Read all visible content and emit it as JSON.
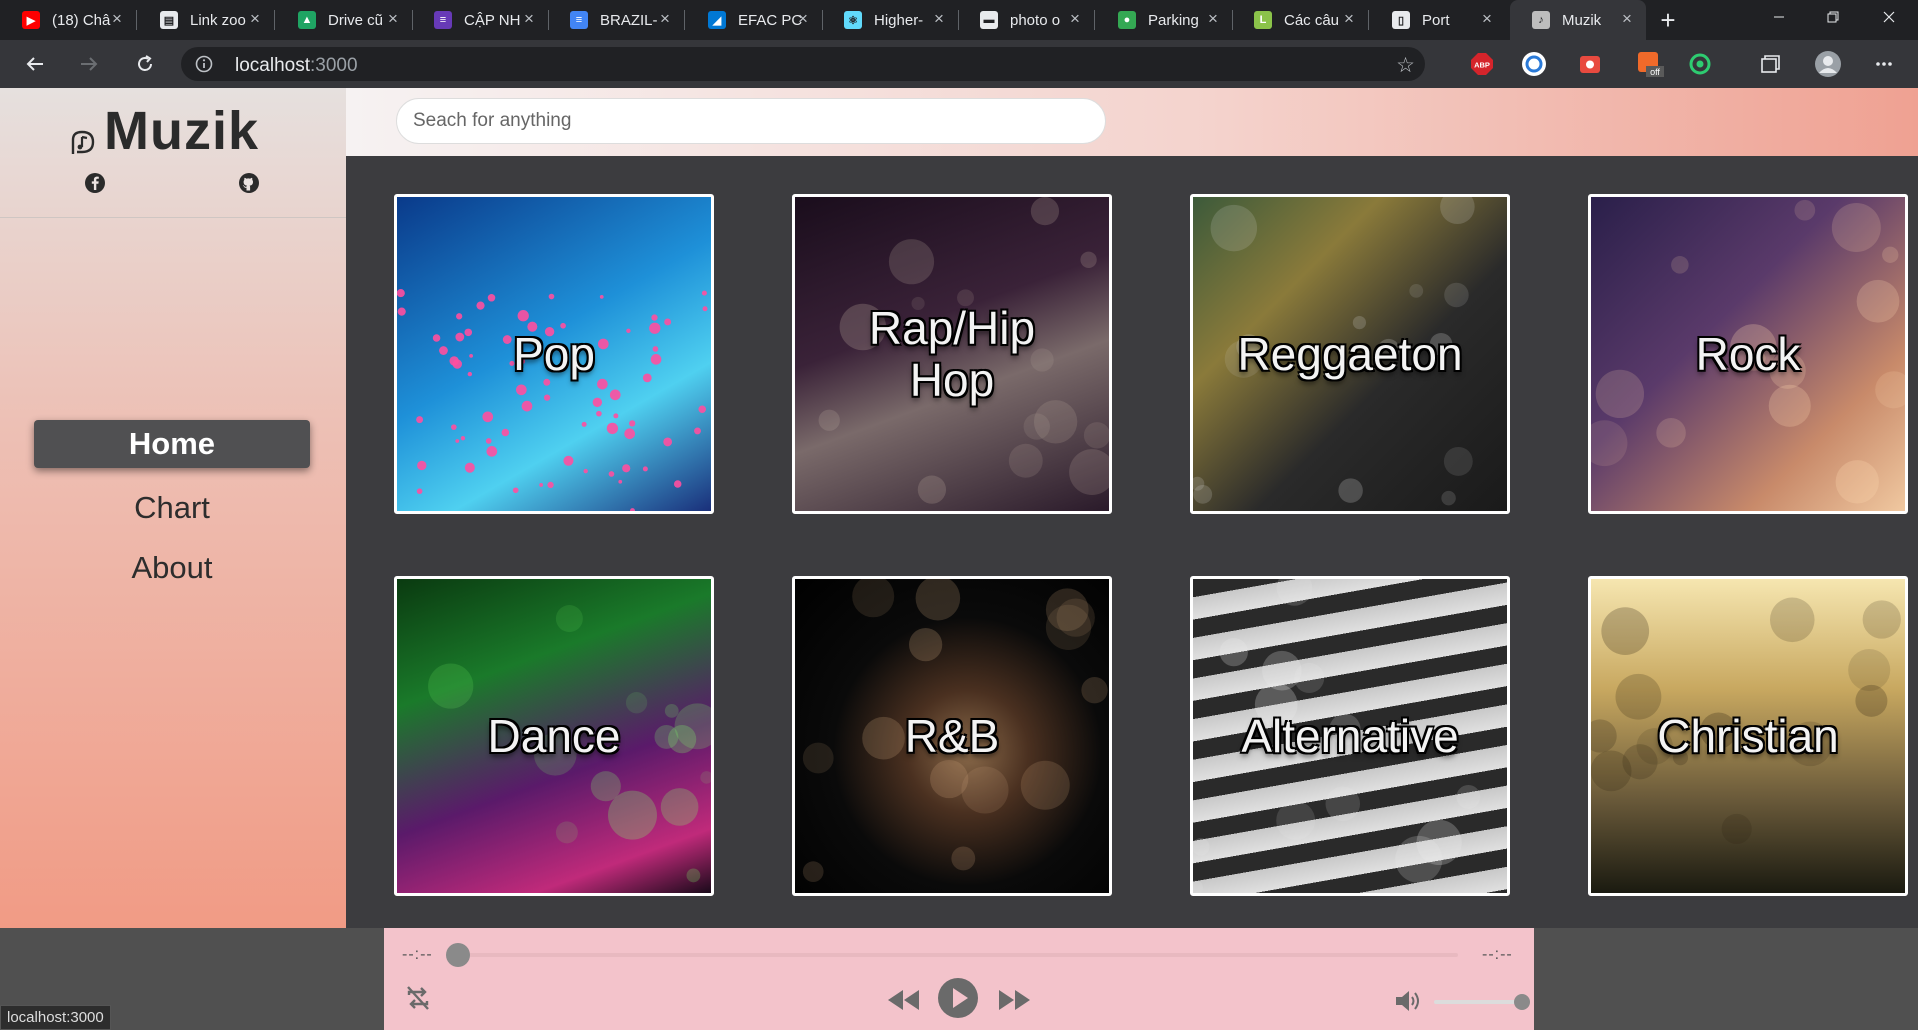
{
  "browser": {
    "tabs": [
      {
        "title": "(18) Châ",
        "icon": "youtube-icon",
        "color": "#ff0000",
        "glyph": "▶"
      },
      {
        "title": "Link zoo",
        "icon": "document-icon",
        "color": "#e8eaed",
        "glyph": "▤"
      },
      {
        "title": "Drive cũ",
        "icon": "google-drive-icon",
        "color": "#1fa463",
        "glyph": "▲"
      },
      {
        "title": "CẬP NH",
        "icon": "forms-icon",
        "color": "#673ab7",
        "glyph": "≡"
      },
      {
        "title": "BRAZIL-",
        "icon": "google-docs-icon",
        "color": "#4285f4",
        "glyph": "≡"
      },
      {
        "title": "EFAC PC",
        "icon": "azure-icon",
        "color": "#0078d4",
        "glyph": "◢"
      },
      {
        "title": "Higher-",
        "icon": "react-icon",
        "color": "#61dafb",
        "glyph": "⚛"
      },
      {
        "title": "photo o",
        "icon": "unsplash-icon",
        "color": "#e8eaed",
        "glyph": "▬"
      },
      {
        "title": "Parking",
        "icon": "maps-pin-icon",
        "color": "#34a853",
        "glyph": "●"
      },
      {
        "title": "Các câu",
        "icon": "tab-l-icon",
        "color": "#8bc34a",
        "glyph": "L"
      },
      {
        "title": "Port",
        "icon": "page-icon",
        "color": "#e8eaed",
        "glyph": "▯"
      },
      {
        "title": "Muzik",
        "icon": "muzik-logo-icon",
        "color": "#bdbdbd",
        "glyph": "♪",
        "active": true
      }
    ],
    "url_host": "localhost",
    "url_port": ":3000",
    "status_url": "localhost:3000"
  },
  "app": {
    "brand": "Muzik",
    "nav": [
      {
        "label": "Home",
        "active": true
      },
      {
        "label": "Chart",
        "active": false
      },
      {
        "label": "About",
        "active": false
      }
    ],
    "search_placeholder": "Seach for anything"
  },
  "genres": [
    {
      "name": "Pop",
      "bg": "linear-gradient(150deg,#0a3a8a 0%,#1e90d8 45%,#4fd0f0 70%,#1a2f7a 100%)",
      "accent": "#ff4fa0"
    },
    {
      "name": "Rap/Hip Hop",
      "bg": "linear-gradient(160deg,#1a0d1c 0%,#3a2238 40%,#7a6a6a 60%,#2a1a2a 100%)",
      "accent": "#c9b7a8"
    },
    {
      "name": "Reggaeton",
      "bg": "linear-gradient(135deg,#3c5a3a 0%,#8a7a3a 30%,#2a2a2a 60%,#1a1a1a 100%)",
      "accent": "#d8d8d8"
    },
    {
      "name": "Rock",
      "bg": "linear-gradient(135deg,#2a1f4a 0%,#5a3a6a 40%,#c88a6a 75%,#f0c8a0 100%)",
      "accent": "#ffd9b0"
    },
    {
      "name": "Dance",
      "bg": "linear-gradient(160deg,#0a3a10 0%,#1a7a2a 30%,#5a1a6a 60%,#c02a7a 85%,#1a0a1a 100%)",
      "accent": "#7fff6a"
    },
    {
      "name": "R&B",
      "bg": "radial-gradient(circle at 55% 55%,#8a6a4a 0%,#4a3020 25%,#0a0a0a 55%,#000 100%)",
      "accent": "#c9a27a"
    },
    {
      "name": "Alternative",
      "bg": "repeating-linear-gradient(170deg,#2a2a2a 0px,#2a2a2a 18px,#c8c8c8 18px,#e0e0e0 40px)",
      "accent": "#eeeeee"
    },
    {
      "name": "Christian",
      "bg": "linear-gradient(180deg,#f6e6b0 0%,#c8a860 35%,#6a5a3a 70%,#1a1a10 100%)",
      "accent": "#2a2010"
    }
  ],
  "player": {
    "current_time": "--:--",
    "total_time": "--:--",
    "progress": 0,
    "volume": 1.0
  },
  "colors": {
    "sidebar_active": "#505052",
    "player_bg": "#f3c3cb",
    "content_bg": "#3c3c3f"
  }
}
